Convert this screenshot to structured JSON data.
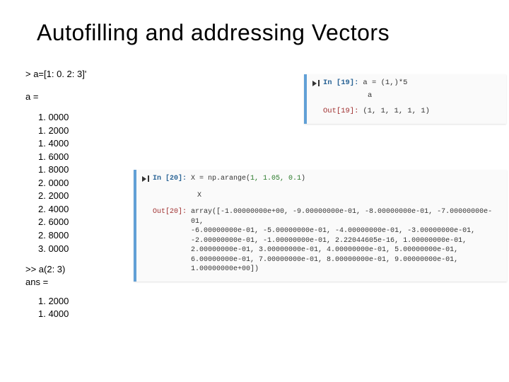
{
  "title": "Autofilling and addressing Vectors",
  "matlab": {
    "cmd1": "> a=[1: 0. 2: 3]'",
    "label": "a =",
    "values": [
      "1. 0000",
      "1. 2000",
      "1. 4000",
      "1. 6000",
      "1. 8000",
      "2. 0000",
      "2. 2000",
      "2. 4000",
      "2. 6000",
      "2. 8000",
      "3. 0000"
    ],
    "cmd2": ">> a(2: 3)",
    "ans": "ans =",
    "values2": [
      "1. 2000",
      "1. 4000"
    ]
  },
  "jup1": {
    "in_prompt": "In [19]:",
    "code": "a = (1,)*5",
    "expr": "a",
    "out_prompt": "Out[19]:",
    "out_val": "(1, 1, 1, 1, 1)"
  },
  "jup2": {
    "in_prompt": "In [20]:",
    "code_pre": "X = np.arange(",
    "code_args": "1, 1.05, 0.1",
    "code_post": ")",
    "expr": "X",
    "out_prompt": "Out[20]:",
    "array_lines": [
      "array([-1.00000000e+00, -9.00000000e-01, -8.00000000e-01, -7.00000000e-01,",
      "       -6.00000000e-01, -5.00000000e-01, -4.00000000e-01, -3.00000000e-01,",
      "       -2.00000000e-01, -1.00000000e-01,  2.22044605e-16,  1.00000000e-01,",
      "        2.00000000e-01,  3.00000000e-01,  4.00000000e-01,  5.00000000e-01,",
      "        6.00000000e-01,  7.00000000e-01,  8.00000000e-01,  9.00000000e-01,",
      "        1.00000000e+00])"
    ]
  }
}
